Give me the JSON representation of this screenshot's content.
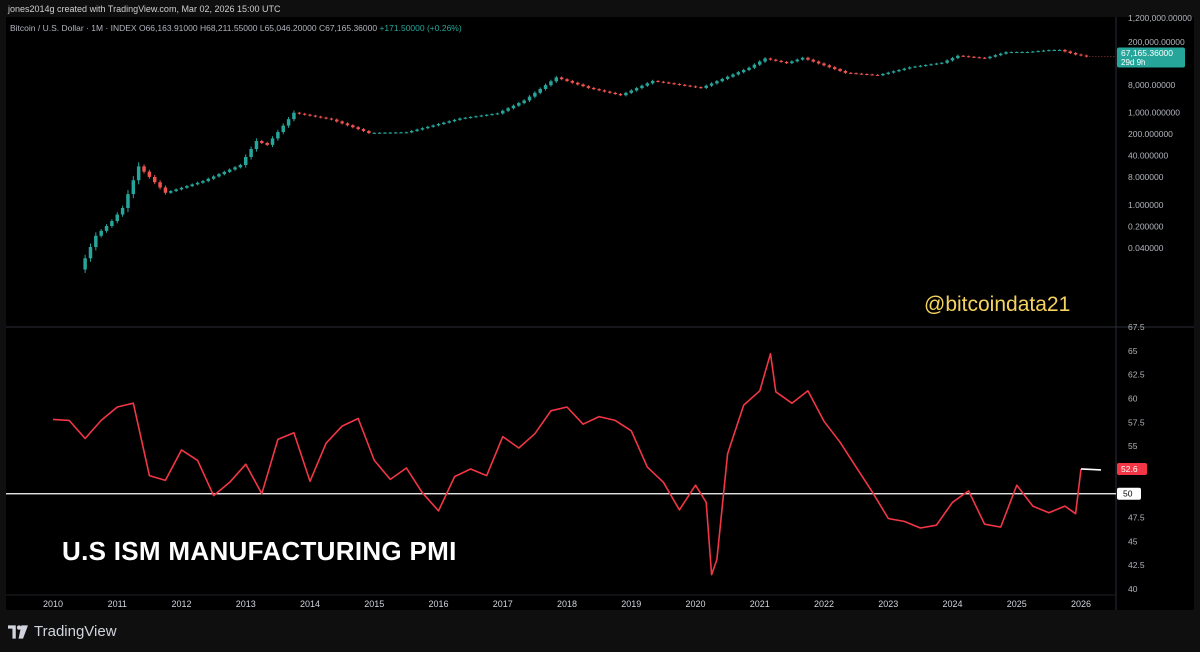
{
  "header": {
    "created_by": "jones2014g created with TradingView.com, Mar 02, 2026 15:00 UTC"
  },
  "legend": {
    "symbol": "Bitcoin / U.S. Dollar · 1M · INDEX",
    "open": "O66,163.91000",
    "high": "H68,211.55000",
    "low": "L65,046.20000",
    "close": "C67,165.36000",
    "change": "+171.50000 (+0.26%)"
  },
  "watermark": "@bitcoindata21",
  "pmi_title": "U.S ISM MANUFACTURING PMI",
  "brand": "TradingView",
  "colors": {
    "background": "#000000",
    "up_candle": "#26a69a",
    "down_candle": "#ef5350",
    "pmi_line": "#f23645",
    "reference_line": "#ffffff",
    "price_badge": "#26a69a",
    "pmi_badge": "#f23645",
    "watermark": "#f4d35e"
  },
  "chart_data": [
    {
      "type": "candlestick",
      "name": "Bitcoin / U.S. Dollar",
      "scale": "log",
      "price_label": "67,165.36000",
      "countdown": "29d 9h",
      "ylim": [
        0.004,
        1500000
      ],
      "y_ticks": [
        "1,200,000.00000",
        "200,000.00000",
        "40,000.00000",
        "8,000.00000",
        "1,000.000000",
        "200.000000",
        "40.000000",
        "8.000000",
        "1.000000",
        "0.200000",
        "0.040000"
      ],
      "y_tick_values": [
        1200000,
        200000,
        40000,
        8000,
        1000,
        200,
        40,
        8,
        1,
        0.2,
        0.04
      ],
      "anchors": [
        [
          "2010-07",
          0.008
        ],
        [
          "2010-10",
          0.1
        ],
        [
          "2011-01",
          0.3
        ],
        [
          "2011-03",
          0.8
        ],
        [
          "2011-06",
          18
        ],
        [
          "2011-11",
          2.5
        ],
        [
          "2012-06",
          6
        ],
        [
          "2013-01",
          20
        ],
        [
          "2013-04",
          120
        ],
        [
          "2013-06",
          90
        ],
        [
          "2013-11",
          1000
        ],
        [
          "2014-06",
          600
        ],
        [
          "2015-01",
          220
        ],
        [
          "2015-08",
          230
        ],
        [
          "2016-06",
          650
        ],
        [
          "2017-01",
          950
        ],
        [
          "2017-06",
          2500
        ],
        [
          "2017-12",
          14000
        ],
        [
          "2018-06",
          6400
        ],
        [
          "2018-12",
          3700
        ],
        [
          "2019-06",
          10800
        ],
        [
          "2020-03",
          6400
        ],
        [
          "2020-12",
          29000
        ],
        [
          "2021-03",
          58000
        ],
        [
          "2021-07",
          41000
        ],
        [
          "2021-10",
          61000
        ],
        [
          "2022-06",
          19800
        ],
        [
          "2022-12",
          16500
        ],
        [
          "2023-06",
          30000
        ],
        [
          "2023-12",
          42000
        ],
        [
          "2024-03",
          71000
        ],
        [
          "2024-08",
          59000
        ],
        [
          "2024-12",
          93000
        ],
        [
          "2025-04",
          94000
        ],
        [
          "2025-08",
          108000
        ],
        [
          "2025-10",
          110000
        ],
        [
          "2026-01",
          78000
        ],
        [
          "2026-03",
          67165
        ]
      ]
    },
    {
      "type": "line",
      "name": "U.S ISM Manufacturing PMI",
      "last_value_label": "52.6",
      "reference_value": 50,
      "reference_label": "50",
      "ylim": [
        40,
        67.5
      ],
      "y_ticks": [
        "67.5",
        "65",
        "62.5",
        "60",
        "57.5",
        "55",
        "52.5",
        "50",
        "47.5",
        "45",
        "42.5",
        "40"
      ],
      "y_tick_values": [
        67.5,
        65,
        62.5,
        60,
        57.5,
        55,
        52.5,
        50,
        47.5,
        45,
        42.5,
        40
      ],
      "x": [
        "2010-01",
        "2010-04",
        "2010-07",
        "2010-10",
        "2011-01",
        "2011-04",
        "2011-07",
        "2011-10",
        "2012-01",
        "2012-04",
        "2012-07",
        "2012-10",
        "2013-01",
        "2013-04",
        "2013-07",
        "2013-10",
        "2014-01",
        "2014-04",
        "2014-07",
        "2014-10",
        "2015-01",
        "2015-04",
        "2015-07",
        "2015-10",
        "2016-01",
        "2016-04",
        "2016-07",
        "2016-10",
        "2017-01",
        "2017-04",
        "2017-07",
        "2017-10",
        "2018-01",
        "2018-04",
        "2018-07",
        "2018-10",
        "2019-01",
        "2019-04",
        "2019-07",
        "2019-10",
        "2020-01",
        "2020-03",
        "2020-04",
        "2020-05",
        "2020-07",
        "2020-10",
        "2021-01",
        "2021-03",
        "2021-04",
        "2021-07",
        "2021-10",
        "2022-01",
        "2022-04",
        "2022-07",
        "2022-10",
        "2023-01",
        "2023-04",
        "2023-07",
        "2023-10",
        "2024-01",
        "2024-04",
        "2024-07",
        "2024-10",
        "2025-01",
        "2025-04",
        "2025-07",
        "2025-10",
        "2025-12",
        "2026-01"
      ],
      "values": [
        57.8,
        57.7,
        55.8,
        57.7,
        59.1,
        59.5,
        51.9,
        51.4,
        54.6,
        53.5,
        49.8,
        51.2,
        53.1,
        50.0,
        55.7,
        56.4,
        51.3,
        55.3,
        57.1,
        57.9,
        53.5,
        51.5,
        52.7,
        50.1,
        48.2,
        51.8,
        52.6,
        51.9,
        56.0,
        54.8,
        56.3,
        58.7,
        59.1,
        57.3,
        58.1,
        57.7,
        56.6,
        52.8,
        51.2,
        48.3,
        50.9,
        49.1,
        41.5,
        43.1,
        54.2,
        59.3,
        60.8,
        64.7,
        60.7,
        59.5,
        60.8,
        57.6,
        55.4,
        52.8,
        50.2,
        47.4,
        47.1,
        46.4,
        46.7,
        49.1,
        50.3,
        46.8,
        46.5,
        50.9,
        48.7,
        48.0,
        48.7,
        47.9,
        52.6
      ]
    }
  ],
  "x_axis": {
    "labels": [
      "2010",
      "2011",
      "2012",
      "2013",
      "2014",
      "2015",
      "2016",
      "2017",
      "2018",
      "2019",
      "2020",
      "2021",
      "2022",
      "2023",
      "2024",
      "2025",
      "2026"
    ]
  }
}
